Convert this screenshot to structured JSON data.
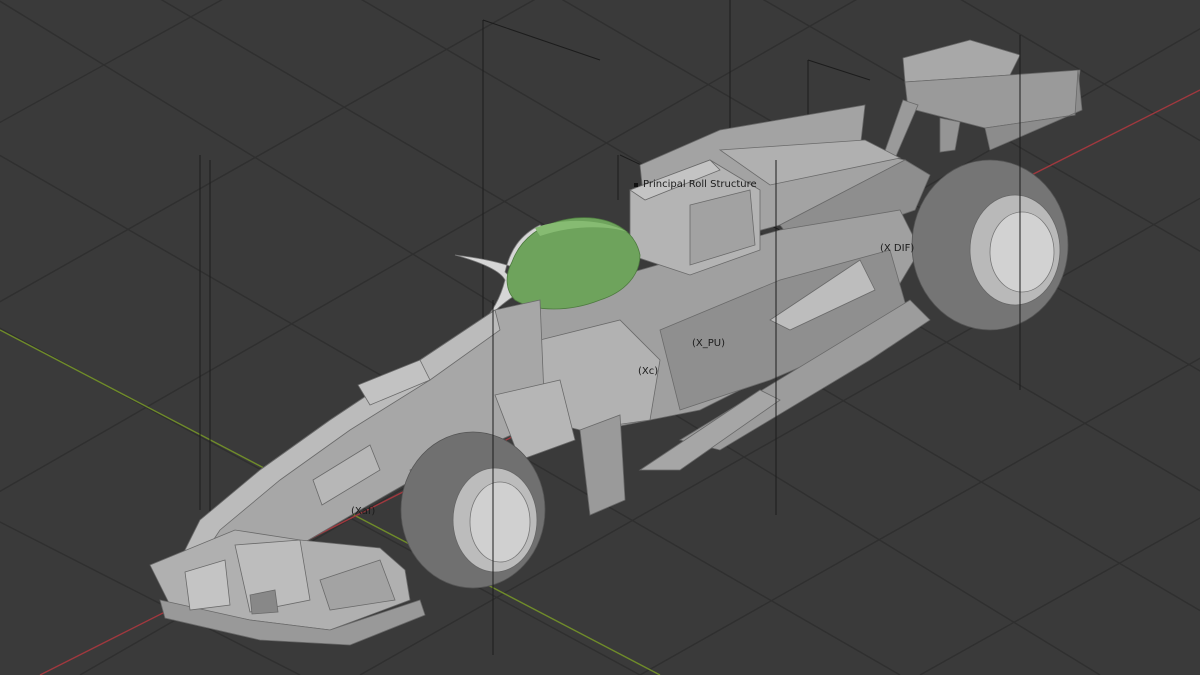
{
  "viewport": {
    "background": "#3a3a3a",
    "grid_color": "#2f2f2f",
    "axis_x_color": "#a0383e",
    "axis_y_color": "#6f8b2a",
    "model_color": "#9a9a9a",
    "cockpit_color": "#6ea35c"
  },
  "annotations": {
    "principal_roll": "Principal Roll Structure",
    "x_dif": "(X DIF)",
    "x_pu": "(X_PU)",
    "x_c": "(Xc)",
    "x_af": "(Xaf)"
  }
}
